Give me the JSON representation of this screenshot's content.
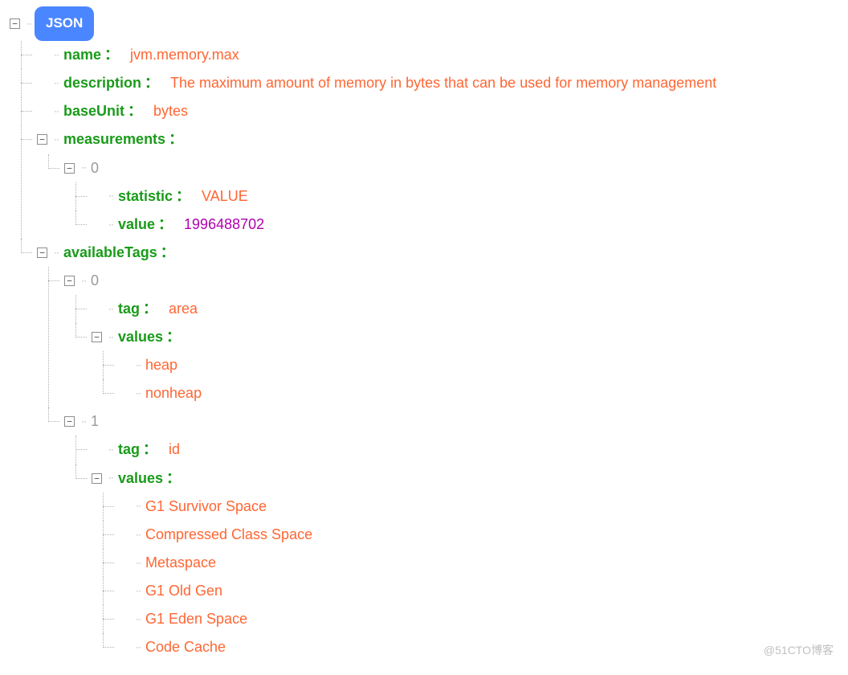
{
  "root_label": "JSON",
  "watermark": "@51CTO博客",
  "tree": {
    "name": {
      "key": "name",
      "value": "jvm.memory.max",
      "type": "str"
    },
    "description": {
      "key": "description",
      "value": "The maximum amount of memory in bytes that can be used for memory management",
      "type": "str"
    },
    "baseUnit": {
      "key": "baseUnit",
      "value": "bytes",
      "type": "str"
    },
    "measurements": {
      "key": "measurements",
      "items": [
        {
          "idx": "0",
          "statistic": {
            "key": "statistic",
            "value": "VALUE",
            "type": "str"
          },
          "value": {
            "key": "value",
            "value": "1996488702",
            "type": "num"
          }
        }
      ]
    },
    "availableTags": {
      "key": "availableTags",
      "items": [
        {
          "idx": "0",
          "tag": {
            "key": "tag",
            "value": "area",
            "type": "str"
          },
          "values": {
            "key": "values",
            "list": [
              "heap",
              "nonheap"
            ]
          }
        },
        {
          "idx": "1",
          "tag": {
            "key": "tag",
            "value": "id",
            "type": "str"
          },
          "values": {
            "key": "values",
            "list": [
              "G1 Survivor Space",
              "Compressed Class Space",
              "Metaspace",
              "G1 Old Gen",
              "G1 Eden Space",
              "Code Cache"
            ]
          }
        }
      ]
    }
  }
}
